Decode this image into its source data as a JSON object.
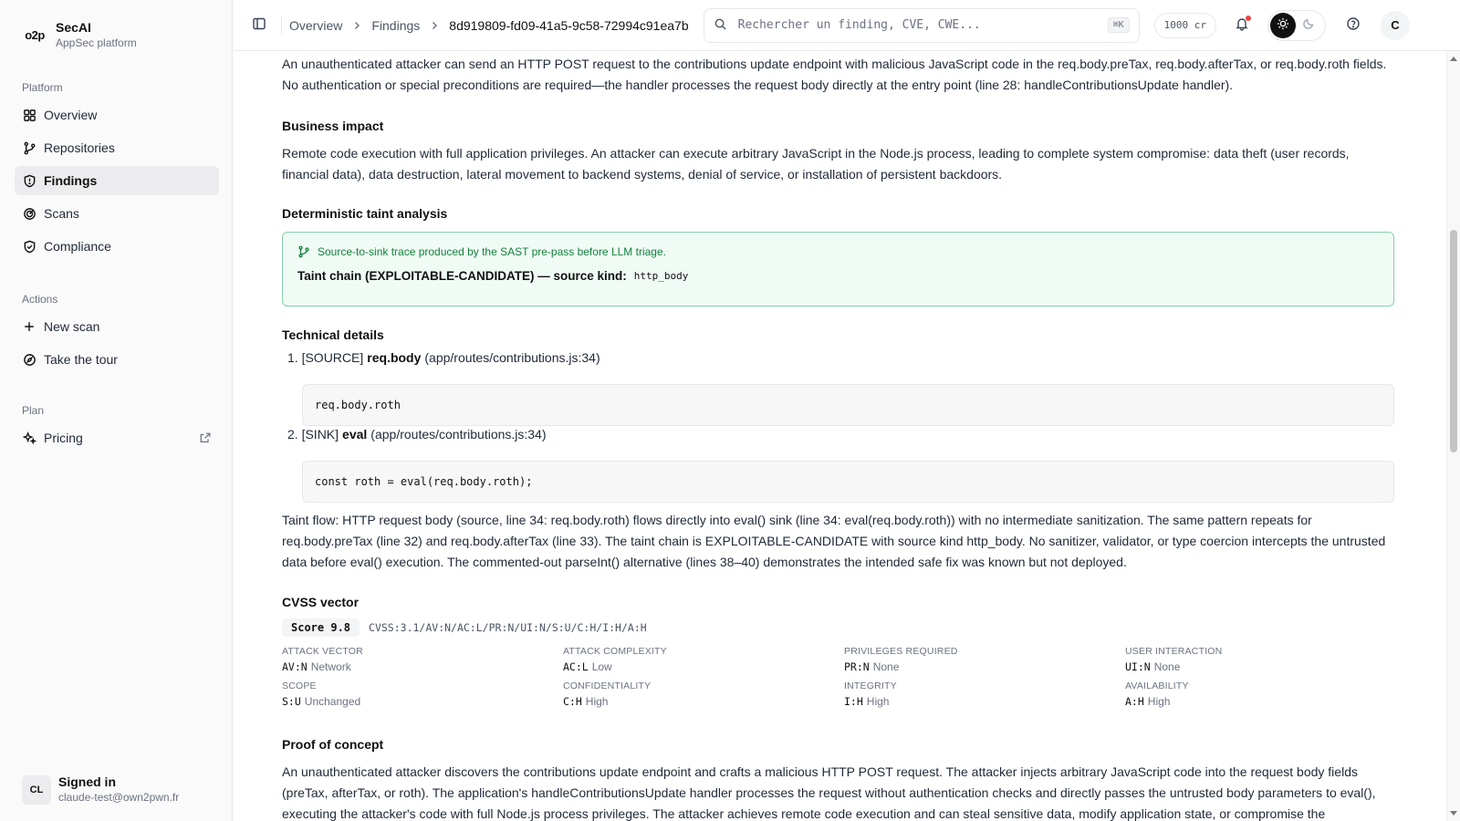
{
  "brand": {
    "logo": "o2p",
    "name": "SecAI",
    "subtitle": "AppSec platform"
  },
  "sidebar": {
    "platform_label": "Platform",
    "platform_items": [
      {
        "label": "Overview",
        "icon": "grid-icon"
      },
      {
        "label": "Repositories",
        "icon": "git-branch-icon"
      },
      {
        "label": "Findings",
        "icon": "shield-icon",
        "active": true
      },
      {
        "label": "Scans",
        "icon": "radar-icon"
      },
      {
        "label": "Compliance",
        "icon": "shield-check-icon"
      }
    ],
    "actions_label": "Actions",
    "action_items": [
      {
        "label": "New scan",
        "icon": "plus-icon"
      },
      {
        "label": "Take the tour",
        "icon": "compass-icon"
      }
    ],
    "plan_label": "Plan",
    "plan_items": [
      {
        "label": "Pricing",
        "icon": "sparkles-icon",
        "external": true
      }
    ],
    "user": {
      "initials": "CL",
      "title": "Signed in",
      "email": "claude-test@own2pwn.fr"
    }
  },
  "topbar": {
    "breadcrumb": [
      "Overview",
      "Findings",
      "8d919809-fd09-41a5-9c58-72994c91ea7b"
    ],
    "search_placeholder": "Rechercher un finding, CVE, CWE...",
    "search_shortcut": "⌘K",
    "credits": "1000 cr",
    "avatar": "C"
  },
  "content": {
    "intro": "An unauthenticated attacker can send an HTTP POST request to the contributions update endpoint with malicious JavaScript code in the req.body.preTax, req.body.afterTax, or req.body.roth fields. No authentication or special preconditions are required—the handler processes the request body directly at the entry point (line 28: handleContributionsUpdate handler).",
    "business_impact_title": "Business impact",
    "business_impact": "Remote code execution with full application privileges. An attacker can execute arbitrary JavaScript in the Node.js process, leading to complete system compromise: data theft (user records, financial data), data destruction, lateral movement to backend systems, denial of service, or installation of persistent backdoors.",
    "taint_title": "Deterministic taint analysis",
    "taint_note": "Source-to-sink trace produced by the SAST pre-pass before LLM triage.",
    "taint_chain": "Taint chain (EXPLOITABLE-CANDIDATE) — source kind:",
    "taint_kind": "http_body",
    "technical_title": "Technical details",
    "steps": [
      {
        "num": "1.",
        "tag": "[SOURCE]",
        "name": "req.body",
        "loc": "(app/routes/contributions.js:34)",
        "code": "req.body.roth"
      },
      {
        "num": "2.",
        "tag": "[SINK]",
        "name": "eval",
        "loc": "(app/routes/contributions.js:34)",
        "code": "const roth = eval(req.body.roth);"
      }
    ],
    "taint_flow": "Taint flow: HTTP request body (source, line 34: req.body.roth) flows directly into eval() sink (line 34: eval(req.body.roth)) with no intermediate sanitization. The same pattern repeats for req.body.preTax (line 32) and req.body.afterTax (line 33). The taint chain is EXPLOITABLE-CANDIDATE with source kind http_body. No sanitizer, validator, or type coercion intercepts the untrusted data before eval() execution. The commented-out parseInt() alternative (lines 38–40) demonstrates the intended safe fix was known but not deployed.",
    "cvss_title": "CVSS vector",
    "cvss_score": "Score 9.8",
    "cvss_vector": "CVSS:3.1/AV:N/AC:L/PR:N/UI:N/S:U/C:H/I:H/A:H",
    "metrics": [
      {
        "label": "Attack vector",
        "code": "AV:N",
        "value": "Network"
      },
      {
        "label": "Attack complexity",
        "code": "AC:L",
        "value": "Low"
      },
      {
        "label": "Privileges required",
        "code": "PR:N",
        "value": "None"
      },
      {
        "label": "User interaction",
        "code": "UI:N",
        "value": "None"
      },
      {
        "label": "Scope",
        "code": "S:U",
        "value": "Unchanged"
      },
      {
        "label": "Confidentiality",
        "code": "C:H",
        "value": "High"
      },
      {
        "label": "Integrity",
        "code": "I:H",
        "value": "High"
      },
      {
        "label": "Availability",
        "code": "A:H",
        "value": "High"
      }
    ],
    "poc_title": "Proof of concept",
    "poc": "An unauthenticated attacker discovers the contributions update endpoint and crafts a malicious HTTP POST request. The attacker injects arbitrary JavaScript code into the request body fields (preTax, afterTax, or roth). The application's handleContributionsUpdate handler processes the request without authentication checks and directly passes the untrusted body parameters to eval(), executing the attacker's code with full Node.js process privileges. The attacker achieves remote code execution and can steal sensitive data, modify application state, or compromise the"
  },
  "colors": {
    "accent_green": "#15803d",
    "taint_border": "#86d1ae",
    "notification": "#ef4444"
  }
}
